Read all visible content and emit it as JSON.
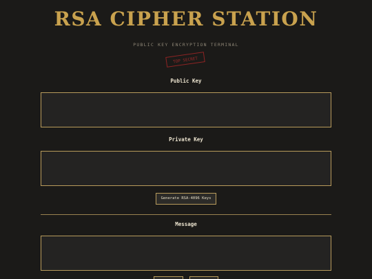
{
  "header": {
    "title": "RSA CIPHER STATION",
    "subtitle": "PUBLIC KEY ENCRYPTION TERMINAL",
    "stamp": "TOP SECRET"
  },
  "public_key": {
    "label": "Public Key",
    "value": ""
  },
  "private_key": {
    "label": "Private Key",
    "value": ""
  },
  "generate_button": {
    "label": "Generate RSA-4096 Keys"
  },
  "message": {
    "label": "Message",
    "value": ""
  },
  "colors": {
    "background": "#1b1a18",
    "accent_gold": "#c9a24e",
    "field_border": "#b99c5c",
    "stamp_red": "#8f2424"
  }
}
